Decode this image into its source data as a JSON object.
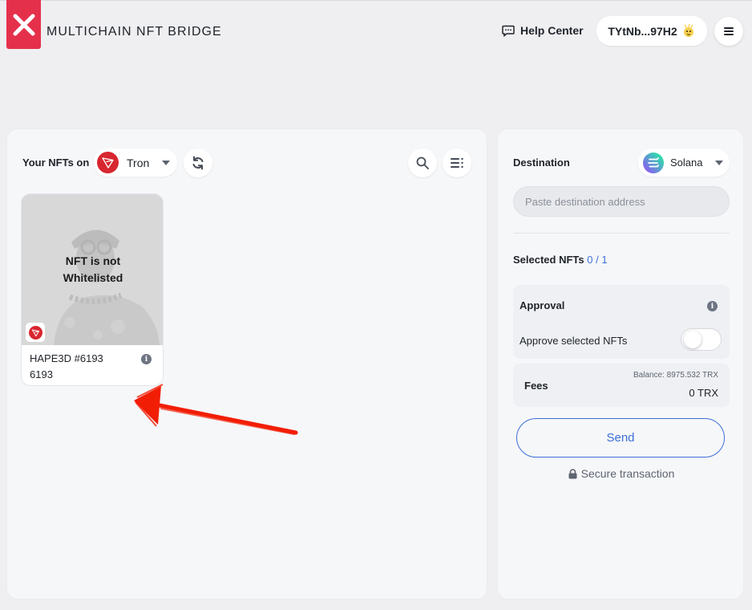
{
  "header": {
    "brand": "MULTICHAIN NFT BRIDGE",
    "help_label": "Help Center",
    "wallet_address": "TYtNb...97H2"
  },
  "source": {
    "label": "Your NFTs on",
    "chain": "Tron"
  },
  "nft": {
    "overlay_line1": "NFT is not",
    "overlay_line2": "Whitelisted",
    "name": "HAPE3D #6193",
    "token_id": "6193"
  },
  "destination": {
    "label": "Destination",
    "chain": "Solana",
    "address_placeholder": "Paste destination address",
    "address_value": ""
  },
  "selection": {
    "label": "Selected NFTs",
    "count": "0 / 1"
  },
  "approval": {
    "title": "Approval",
    "toggle_label": "Approve selected NFTs",
    "enabled": false
  },
  "fees": {
    "label": "Fees",
    "balance": "Balance: 8975.532 TRX",
    "amount": "0 TRX"
  },
  "actions": {
    "send_label": "Send",
    "secure_label": "Secure transaction"
  },
  "colors": {
    "brand_red": "#e5304b",
    "tron_red": "#d8262f",
    "link_blue": "#3c6fd9",
    "annotation_red": "#f21d05"
  }
}
